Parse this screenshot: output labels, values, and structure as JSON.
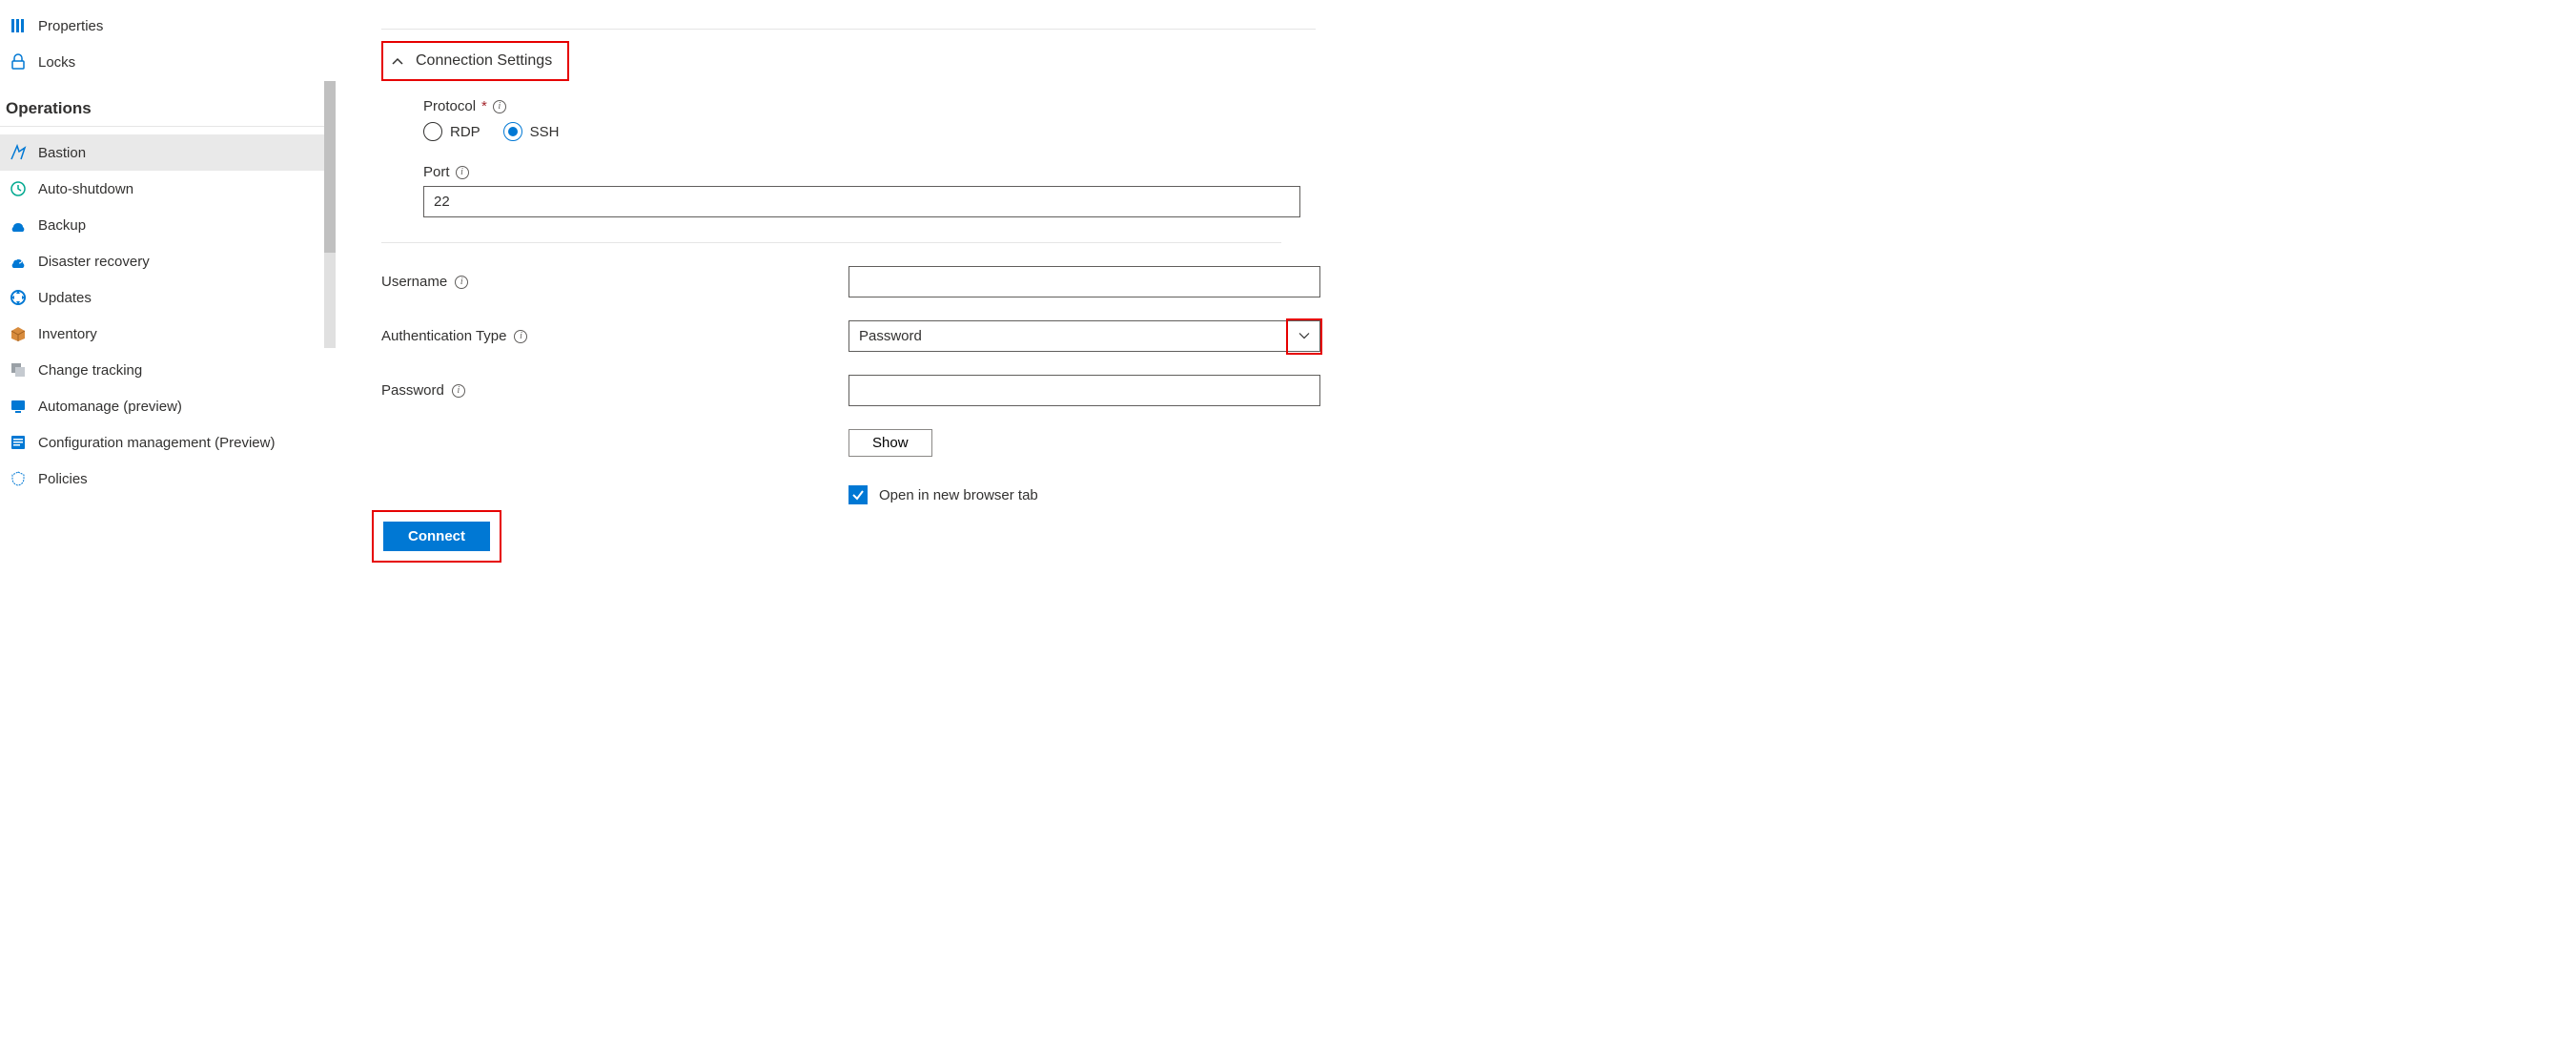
{
  "sidebar": {
    "items": [
      {
        "label": "Properties",
        "icon": "properties"
      },
      {
        "label": "Locks",
        "icon": "lock"
      }
    ],
    "section_title": "Operations",
    "operations": [
      {
        "label": "Bastion",
        "icon": "bastion",
        "selected": true
      },
      {
        "label": "Auto-shutdown",
        "icon": "clock"
      },
      {
        "label": "Backup",
        "icon": "backup"
      },
      {
        "label": "Disaster recovery",
        "icon": "recovery"
      },
      {
        "label": "Updates",
        "icon": "updates"
      },
      {
        "label": "Inventory",
        "icon": "inventory"
      },
      {
        "label": "Change tracking",
        "icon": "tracking"
      },
      {
        "label": "Automanage (preview)",
        "icon": "automanage"
      },
      {
        "label": "Configuration management (Preview)",
        "icon": "config"
      },
      {
        "label": "Policies",
        "icon": "policies"
      }
    ]
  },
  "form": {
    "section_header": "Connection Settings",
    "protocol_label": "Protocol",
    "protocol_options": {
      "rdp": "RDP",
      "ssh": "SSH"
    },
    "protocol_selected": "ssh",
    "port_label": "Port",
    "port_value": "22",
    "username_label": "Username",
    "username_value": "",
    "auth_type_label": "Authentication Type",
    "auth_type_value": "Password",
    "password_label": "Password",
    "password_value": "",
    "show_button_label": "Show",
    "new_tab_label": "Open in new browser tab",
    "new_tab_checked": true,
    "connect_button_label": "Connect"
  }
}
